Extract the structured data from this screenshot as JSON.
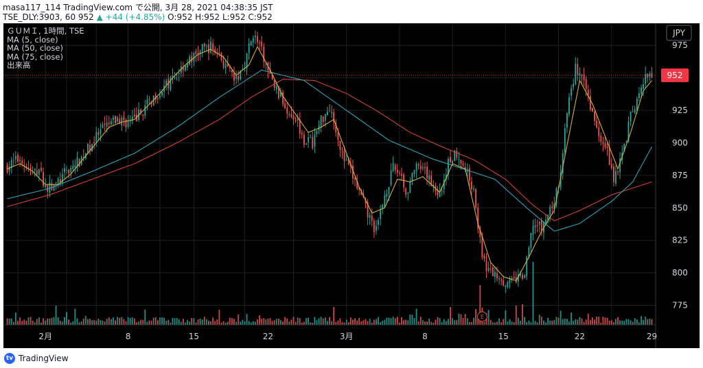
{
  "header": {
    "line1": "masa117_114 TradingView.com で公開, 3月 28, 2021 04:38:35 JST",
    "line2_prefix": "TSE_DLY:3903, 60 952 ",
    "line2_change": "▲ +44 (+4.85%) ",
    "line2_ohlc": "O:952 H:952 L:952 C:952"
  },
  "legend": {
    "title": "ＧＵＭＩ, 1時間, TSE",
    "ma5": "MA (5, close)",
    "ma50": "MA (50, close)",
    "ma75": "MA (75, close)",
    "volume": "出来高"
  },
  "footer": {
    "brand": "TradingView",
    "logo": "tradingview-logo-icon"
  },
  "colors": {
    "background": "#000000",
    "up": "#26a69a",
    "down": "#ef5350",
    "ma5": "#d4b13a",
    "ma50": "#2aa6b8",
    "ma75": "#d2403a",
    "grid": "#1c1f26",
    "text": "#d1d4dc",
    "price_badge": "#f23645"
  },
  "chart_data": {
    "type": "candlestick",
    "title": "ＧＵＭＩ, 1時間, TSE",
    "currency": "JPY",
    "ylim": [
      760,
      992
    ],
    "yticks": [
      775,
      800,
      825,
      850,
      875,
      900,
      925,
      950,
      975
    ],
    "yticks_shown": [
      775,
      800,
      825,
      850,
      875,
      900,
      925,
      975
    ],
    "last_price": 952,
    "xticks": [
      "2月",
      "8",
      "15",
      "22",
      "3月",
      "8",
      "15",
      "22",
      "29"
    ],
    "grid": true,
    "legend_position": "top-left",
    "event_marker": "E",
    "close_anchors": [
      [
        0,
        882
      ],
      [
        6,
        888
      ],
      [
        12,
        876
      ],
      [
        15,
        880
      ],
      [
        18,
        866
      ],
      [
        22,
        866
      ],
      [
        28,
        878
      ],
      [
        34,
        886
      ],
      [
        40,
        900
      ],
      [
        46,
        912
      ],
      [
        52,
        918
      ],
      [
        58,
        915
      ],
      [
        64,
        925
      ],
      [
        70,
        937
      ],
      [
        76,
        945
      ],
      [
        82,
        958
      ],
      [
        88,
        966
      ],
      [
        92,
        972
      ],
      [
        96,
        974
      ],
      [
        100,
        968
      ],
      [
        104,
        955
      ],
      [
        108,
        948
      ],
      [
        112,
        962
      ],
      [
        116,
        984
      ],
      [
        120,
        970
      ],
      [
        124,
        950
      ],
      [
        128,
        938
      ],
      [
        132,
        926
      ],
      [
        136,
        920
      ],
      [
        140,
        903
      ],
      [
        144,
        900
      ],
      [
        148,
        918
      ],
      [
        152,
        928
      ],
      [
        155,
        912
      ],
      [
        158,
        890
      ],
      [
        162,
        878
      ],
      [
        166,
        862
      ],
      [
        170,
        845
      ],
      [
        174,
        832
      ],
      [
        178,
        860
      ],
      [
        182,
        880
      ],
      [
        186,
        876
      ],
      [
        188,
        860
      ],
      [
        192,
        880
      ],
      [
        196,
        878
      ],
      [
        200,
        870
      ],
      [
        204,
        860
      ],
      [
        208,
        885
      ],
      [
        212,
        893
      ],
      [
        216,
        880
      ],
      [
        220,
        865
      ],
      [
        224,
        810
      ],
      [
        228,
        800
      ],
      [
        232,
        798
      ],
      [
        236,
        791
      ],
      [
        240,
        795
      ],
      [
        244,
        798
      ],
      [
        248,
        838
      ],
      [
        252,
        834
      ],
      [
        256,
        848
      ],
      [
        260,
        865
      ],
      [
        264,
        925
      ],
      [
        266,
        940
      ],
      [
        268,
        958
      ],
      [
        270,
        952
      ],
      [
        274,
        936
      ],
      [
        278,
        910
      ],
      [
        282,
        900
      ],
      [
        286,
        873
      ],
      [
        290,
        890
      ],
      [
        294,
        920
      ],
      [
        298,
        935
      ],
      [
        301,
        950
      ],
      [
        304,
        952
      ]
    ],
    "ma_anchors": {
      "ma5": [
        [
          0,
          880
        ],
        [
          6,
          884
        ],
        [
          12,
          878
        ],
        [
          18,
          868
        ],
        [
          24,
          868
        ],
        [
          30,
          876
        ],
        [
          36,
          888
        ],
        [
          42,
          900
        ],
        [
          48,
          912
        ],
        [
          54,
          916
        ],
        [
          60,
          918
        ],
        [
          66,
          928
        ],
        [
          72,
          938
        ],
        [
          78,
          950
        ],
        [
          84,
          960
        ],
        [
          90,
          968
        ],
        [
          96,
          972
        ],
        [
          102,
          966
        ],
        [
          108,
          952
        ],
        [
          114,
          960
        ],
        [
          118,
          974
        ],
        [
          124,
          956
        ],
        [
          130,
          936
        ],
        [
          136,
          922
        ],
        [
          142,
          908
        ],
        [
          148,
          912
        ],
        [
          154,
          918
        ],
        [
          160,
          892
        ],
        [
          166,
          866
        ],
        [
          172,
          846
        ],
        [
          178,
          850
        ],
        [
          184,
          872
        ],
        [
          190,
          870
        ],
        [
          196,
          874
        ],
        [
          204,
          862
        ],
        [
          210,
          884
        ],
        [
          216,
          880
        ],
        [
          222,
          838
        ],
        [
          228,
          808
        ],
        [
          234,
          797
        ],
        [
          240,
          794
        ],
        [
          246,
          812
        ],
        [
          252,
          832
        ],
        [
          258,
          848
        ],
        [
          264,
          898
        ],
        [
          270,
          948
        ],
        [
          276,
          930
        ],
        [
          282,
          905
        ],
        [
          288,
          880
        ],
        [
          294,
          908
        ],
        [
          300,
          940
        ],
        [
          304,
          948
        ]
      ],
      "ma50": [
        [
          0,
          857
        ],
        [
          20,
          865
        ],
        [
          40,
          878
        ],
        [
          60,
          892
        ],
        [
          80,
          912
        ],
        [
          100,
          935
        ],
        [
          120,
          956
        ],
        [
          140,
          948
        ],
        [
          160,
          925
        ],
        [
          180,
          902
        ],
        [
          200,
          888
        ],
        [
          215,
          880
        ],
        [
          230,
          872
        ],
        [
          245,
          850
        ],
        [
          258,
          832
        ],
        [
          270,
          838
        ],
        [
          285,
          855
        ],
        [
          295,
          870
        ],
        [
          304,
          897
        ]
      ],
      "ma75": [
        [
          0,
          851
        ],
        [
          20,
          860
        ],
        [
          40,
          872
        ],
        [
          60,
          884
        ],
        [
          80,
          900
        ],
        [
          100,
          918
        ],
        [
          115,
          935
        ],
        [
          130,
          949
        ],
        [
          145,
          948
        ],
        [
          160,
          938
        ],
        [
          175,
          924
        ],
        [
          190,
          908
        ],
        [
          205,
          897
        ],
        [
          220,
          887
        ],
        [
          235,
          872
        ],
        [
          248,
          852
        ],
        [
          258,
          840
        ],
        [
          270,
          848
        ],
        [
          285,
          860
        ],
        [
          304,
          870
        ]
      ]
    }
  }
}
